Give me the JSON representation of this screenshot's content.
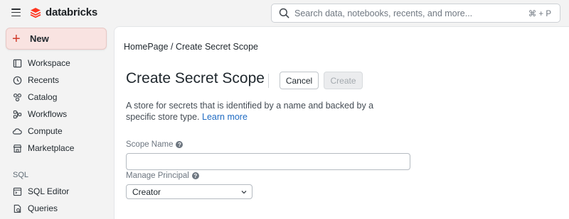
{
  "app": {
    "brand": "databricks",
    "brand_color": "#ff3621"
  },
  "search": {
    "placeholder": "Search data, notebooks, recents, and more...",
    "shortcut": "⌘ + P"
  },
  "sidebar": {
    "new_label": "New",
    "items": [
      {
        "label": "Workspace",
        "icon": "workspace-icon"
      },
      {
        "label": "Recents",
        "icon": "clock-icon"
      },
      {
        "label": "Catalog",
        "icon": "catalog-icon"
      },
      {
        "label": "Workflows",
        "icon": "workflows-icon"
      },
      {
        "label": "Compute",
        "icon": "cloud-icon"
      },
      {
        "label": "Marketplace",
        "icon": "store-icon"
      }
    ],
    "sql_section": "SQL",
    "sql_items": [
      {
        "label": "SQL Editor",
        "icon": "sql-editor-icon"
      },
      {
        "label": "Queries",
        "icon": "queries-icon"
      }
    ]
  },
  "main": {
    "breadcrumb": "HomePage / Create Secret Scope",
    "title": "Create Secret Scope",
    "cancel_label": "Cancel",
    "create_label": "Create",
    "description": "A store for secrets that is identified by a name and backed by a specific store type.",
    "learn_more": "Learn more",
    "scope_name_label": "Scope Name",
    "scope_name_value": "",
    "manage_principal_label": "Manage Principal",
    "manage_principal_value": "Creator"
  }
}
